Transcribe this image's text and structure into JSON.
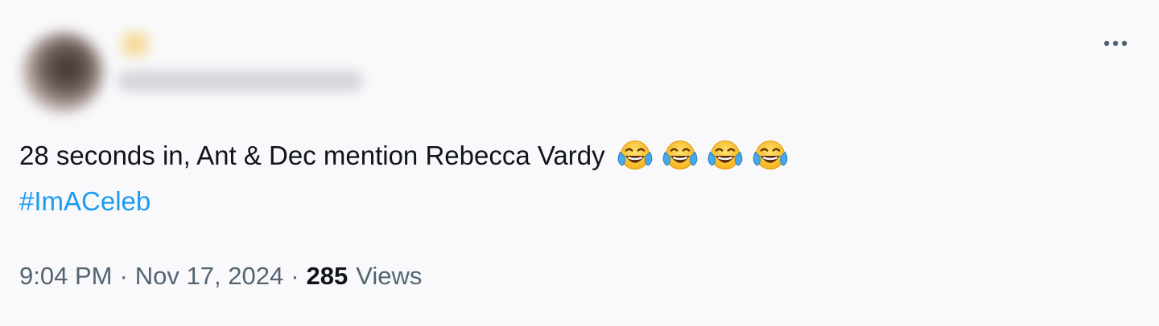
{
  "tweet": {
    "text": "28 seconds in, Ant & Dec mention Rebecca Vardy",
    "emojis": [
      "face-with-tears-of-joy",
      "face-with-tears-of-joy",
      "face-with-tears-of-joy",
      "face-with-tears-of-joy"
    ],
    "hashtag": "#ImACeleb",
    "time": "9:04 PM",
    "date": "Nov 17, 2024",
    "separator": "·",
    "views_count": "285",
    "views_label": "Views"
  },
  "colors": {
    "text": "#0f1419",
    "secondary": "#536471",
    "link": "#1d9bf0",
    "background": "#f9f9fb"
  },
  "icons": {
    "more": "more-horizontal-icon"
  }
}
